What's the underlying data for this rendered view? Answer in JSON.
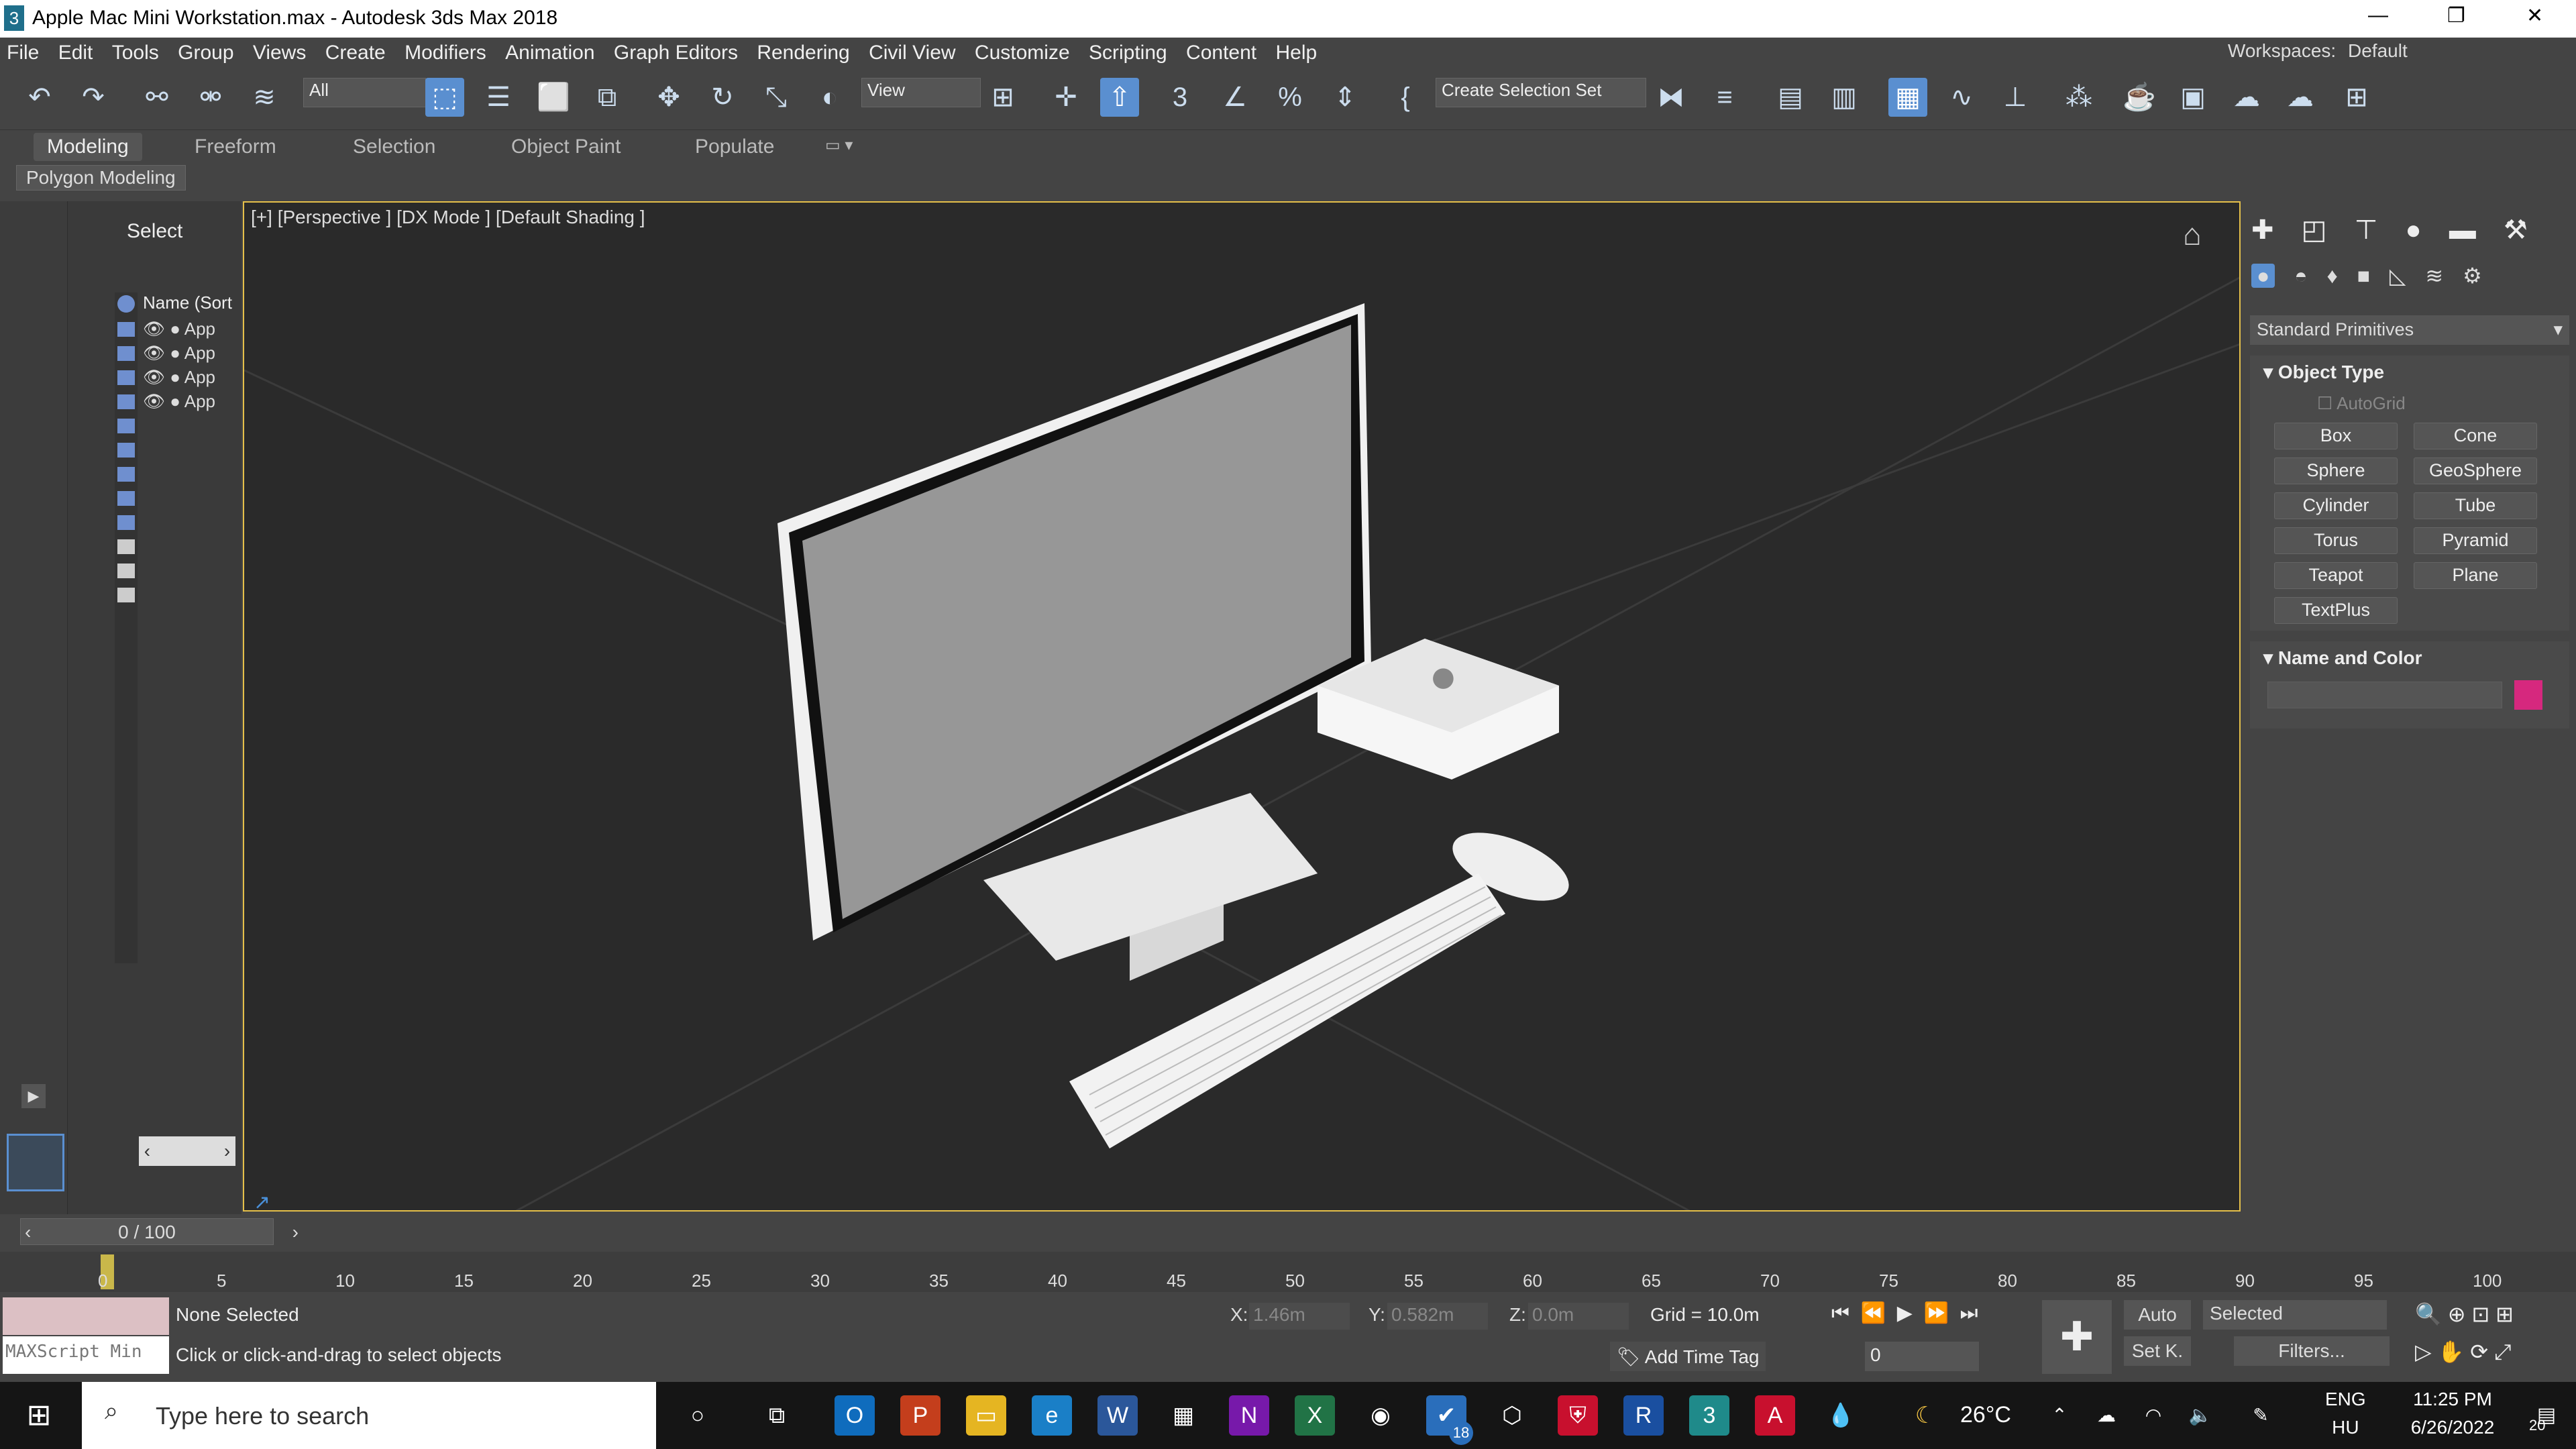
{
  "window": {
    "title": "Apple Mac Mini Workstation.max - Autodesk 3ds Max 2018",
    "icon_label": "3"
  },
  "menu": [
    "File",
    "Edit",
    "Tools",
    "Group",
    "Views",
    "Create",
    "Modifiers",
    "Animation",
    "Graph Editors",
    "Rendering",
    "Civil View",
    "Customize",
    "Scripting",
    "Content",
    "Help"
  ],
  "workspaces": {
    "label": "Workspaces:",
    "value": "Default"
  },
  "toolbar": {
    "filter_value": "All",
    "ref_coord": "View",
    "selection_set": "Create Selection Set"
  },
  "ribbon": {
    "tabs": [
      "Modeling",
      "Freeform",
      "Selection",
      "Object Paint",
      "Populate"
    ],
    "active": "Modeling",
    "panel": "Polygon Modeling"
  },
  "scene_explorer": {
    "title": "Select",
    "column": "Name (Sort",
    "items": [
      "App",
      "App",
      "App",
      "App"
    ]
  },
  "viewport": {
    "label": "[+] [Perspective ]  [DX Mode ]  [Default Shading ]"
  },
  "command_panel": {
    "category": "Standard Primitives",
    "object_type_title": "Object Type",
    "autogrid": "AutoGrid",
    "buttons": [
      "Box",
      "Cone",
      "Sphere",
      "GeoSphere",
      "Cylinder",
      "Tube",
      "Torus",
      "Pyramid",
      "Teapot",
      "Plane",
      "TextPlus"
    ],
    "name_color_title": "Name and Color",
    "color": "#d6287e"
  },
  "timeline": {
    "frame_display": "0 / 100",
    "ticks": [
      "0",
      "5",
      "10",
      "15",
      "20",
      "25",
      "30",
      "35",
      "40",
      "45",
      "50",
      "55",
      "60",
      "65",
      "70",
      "75",
      "80",
      "85",
      "90",
      "95",
      "100"
    ]
  },
  "status": {
    "selection": "None Selected",
    "prompt": "Click or click-and-drag to select objects",
    "maxscript": "MAXScript Min",
    "x_label": "X:",
    "x_value": "1.46m",
    "y_label": "Y:",
    "y_value": "0.582m",
    "z_label": "Z:",
    "z_value": "0.0m",
    "grid": "Grid = 10.0m",
    "add_time_tag": "Add Time Tag",
    "auto": "Auto",
    "selected": "Selected",
    "set_key": "Set K.",
    "filters": "Filters...",
    "frame": "0"
  },
  "taskbar": {
    "search_placeholder": "Type here to search",
    "weather": "26°C",
    "lang1": "ENG",
    "lang2": "HU",
    "time": "11:25 PM",
    "date": "6/26/2022",
    "badge1": "18",
    "notif": "20"
  }
}
